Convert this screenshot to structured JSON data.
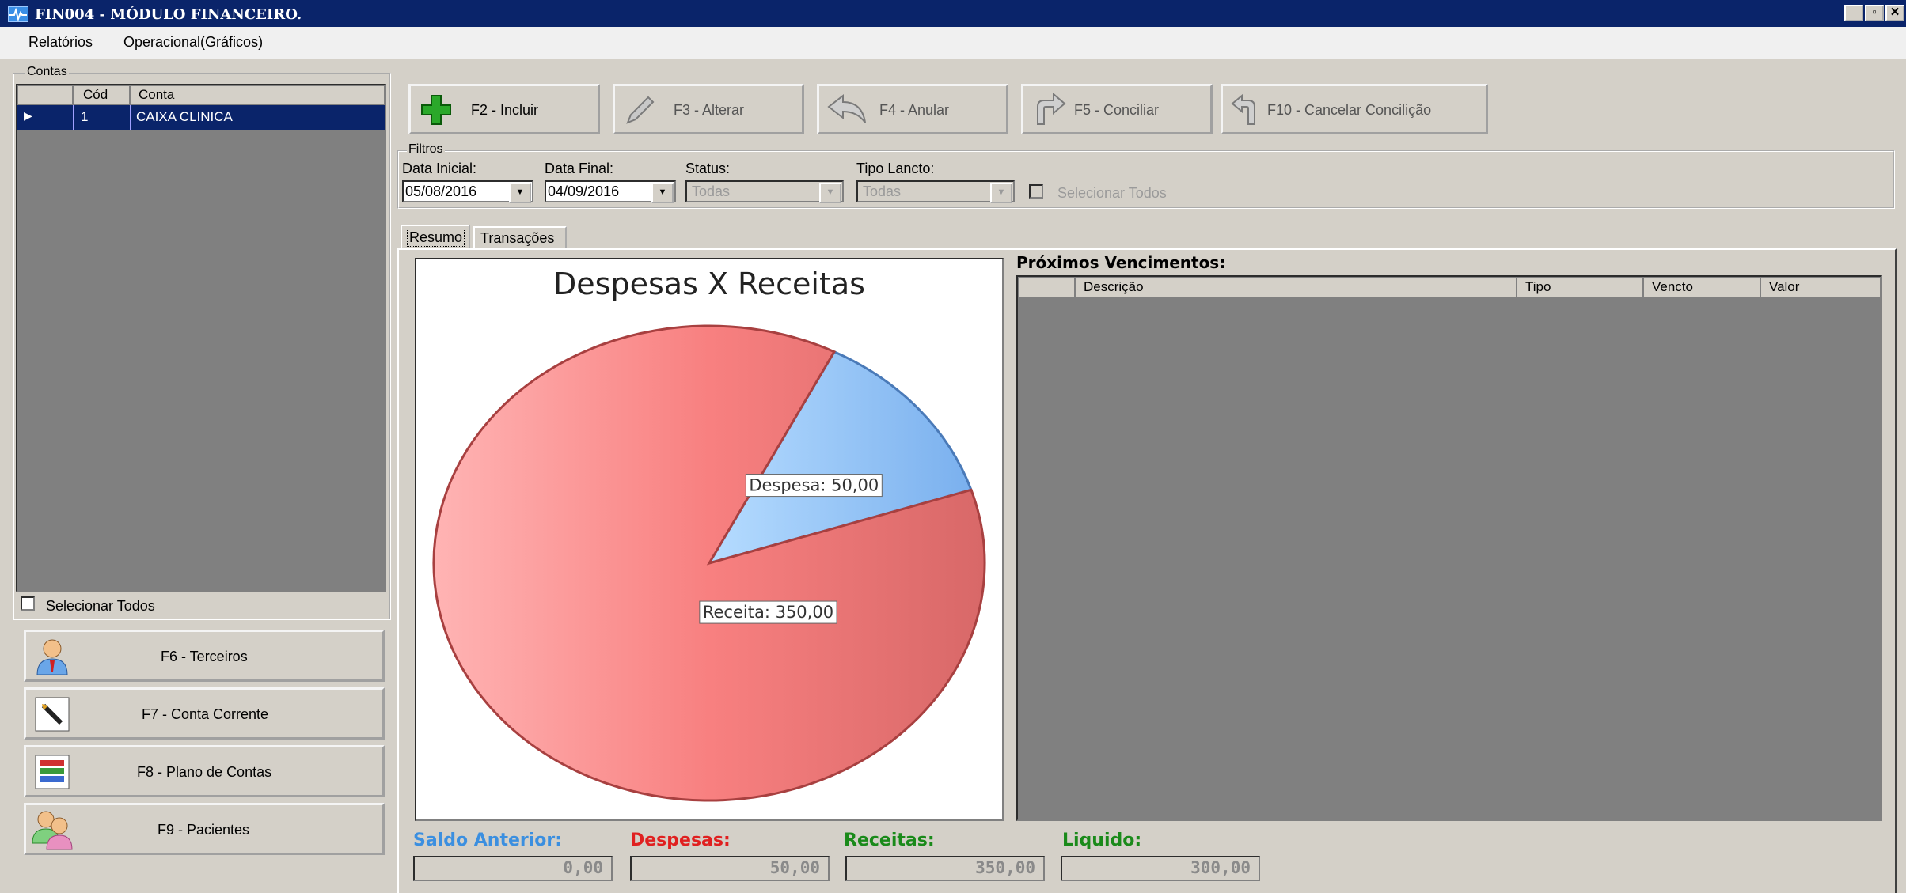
{
  "window": {
    "title": "FIN004 - MÓDULO FINANCEIRO.",
    "icon": "pulse-icon"
  },
  "menu": {
    "items": [
      "Relatórios",
      "Operacional(Gráficos)"
    ]
  },
  "contas": {
    "legend": "Contas",
    "columns": [
      "Cód",
      "Conta"
    ],
    "rows": [
      {
        "cod": "1",
        "conta": "CAIXA CLINICA"
      }
    ],
    "select_all": "Selecionar Todos"
  },
  "side_buttons": [
    {
      "label": "F6 - Terceiros",
      "icon": "person-icon"
    },
    {
      "label": "F7 - Conta Corrente",
      "icon": "pen-icon"
    },
    {
      "label": "F8 - Plano de Contas",
      "icon": "books-icon"
    },
    {
      "label": "F9 - Pacientes",
      "icon": "people-icon"
    }
  ],
  "toolbar": [
    {
      "label": "F2 - Incluir",
      "icon": "plus-icon",
      "enabled": true
    },
    {
      "label": "F3 - Alterar",
      "icon": "pencil-icon",
      "enabled": false
    },
    {
      "label": "F4 - Anular",
      "icon": "undo-arrow-icon",
      "enabled": false
    },
    {
      "label": "F5 - Conciliar",
      "icon": "turn-arrow-icon",
      "enabled": false
    },
    {
      "label": "F10 - Cancelar Concilição",
      "icon": "return-arrow-icon",
      "enabled": false
    }
  ],
  "filtros": {
    "legend": "Filtros",
    "data_inicial_label": "Data Inicial:",
    "data_inicial": "05/08/2016",
    "data_final_label": "Data Final:",
    "data_final": "04/09/2016",
    "status_label": "Status:",
    "status": "Todas",
    "tipo_label": "Tipo Lancto:",
    "tipo": "Todas",
    "select_all": "Selecionar Todos"
  },
  "tabs": [
    "Resumo",
    "Transações"
  ],
  "chart_data": {
    "type": "pie",
    "title": "Despesas X Receitas",
    "slices": [
      {
        "label": "Receita",
        "value": 350,
        "display": "Receita: 350,00",
        "color": "#f47c7c"
      },
      {
        "label": "Despesa",
        "value": 50,
        "display": "Despesa: 50,00",
        "color": "#8dc3f7"
      }
    ]
  },
  "vencimentos": {
    "title": "Próximos Vencimentos:",
    "columns": [
      "Descrição",
      "Tipo",
      "Vencto",
      "Valor"
    ]
  },
  "totals": [
    {
      "label": "Saldo Anterior:",
      "value": "0,00",
      "color": "#3b8fe0"
    },
    {
      "label": "Despesas:",
      "value": "50,00",
      "color": "#e02020"
    },
    {
      "label": "Receitas:",
      "value": "350,00",
      "color": "#1a8a1a"
    },
    {
      "label": "Liquido:",
      "value": "300,00",
      "color": "#1a8a1a"
    }
  ]
}
